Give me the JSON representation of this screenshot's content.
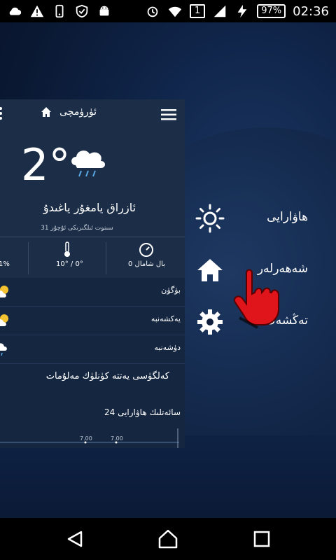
{
  "status_bar": {
    "time": "02:36",
    "battery": "97%",
    "sim_badge": "1"
  },
  "drawer": {
    "items": [
      {
        "label": "ھاۋارايى",
        "icon": "sun-icon"
      },
      {
        "label": "شەھەرلەر",
        "icon": "home-icon"
      },
      {
        "label": "تەڭشەك",
        "icon": "gear-icon"
      }
    ]
  },
  "weather_panel": {
    "city": "ئۈرۈمچى",
    "temperature": "2°",
    "condition": "ئازراق يامغۇر ياغىدۇ",
    "updated": "31 سىنوت ئىلگىرىكى ئۇچۇر",
    "stats": {
      "wind": "0 بال شامال",
      "range": "10° / 0°",
      "humidity": "1%"
    },
    "days": [
      {
        "name": "بۈگۈن",
        "icon": "sun-cloud-icon"
      },
      {
        "name": "يەكشەنبە",
        "icon": "sun-cloud-icon"
      },
      {
        "name": "دۈشەنبە",
        "icon": "rain-cloud-icon"
      }
    ],
    "section_title": "كەلگۈسى يەتتە كۈنلۈك مەلۇمات",
    "hourly_title": "24 سائەتلىك ھاۋارايى",
    "hourly_points": [
      "7.00",
      "7.00"
    ]
  },
  "colors": {
    "status_bar": "#000000",
    "panel": "#1b2d47",
    "cursor": "#e0141b"
  }
}
